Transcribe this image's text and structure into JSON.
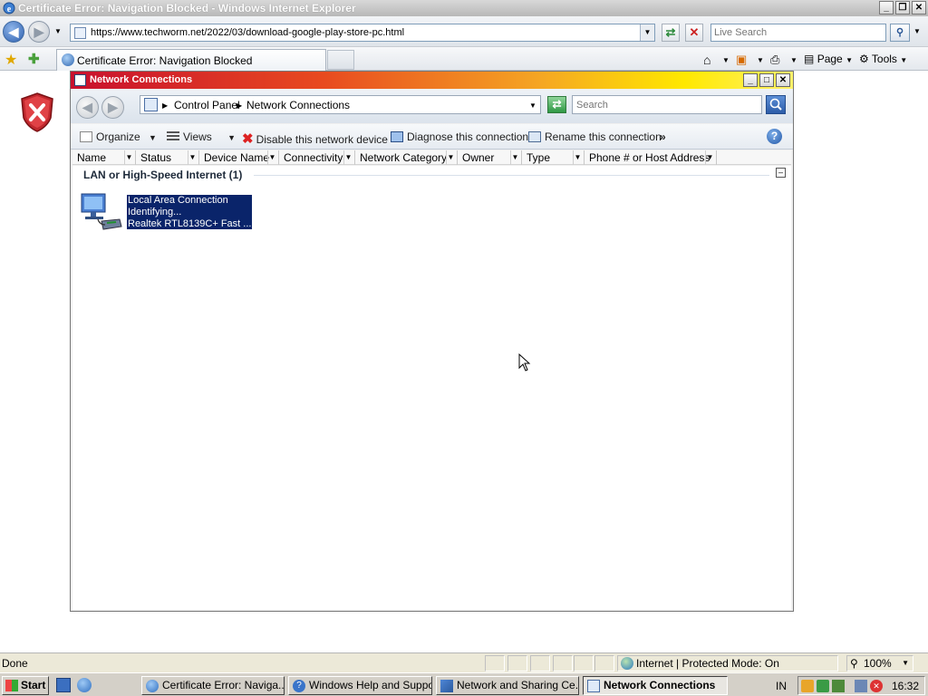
{
  "browser": {
    "title": "Certificate Error: Navigation Blocked - Windows Internet Explorer",
    "url": "https://www.techworm.net/2022/03/download-google-play-store-pc.html",
    "search_placeholder": "Live Search",
    "tab_label": "Certificate Error: Navigation Blocked",
    "page_menu": "Page",
    "tools_menu": "Tools",
    "status_text": "Done",
    "zone_text": "Internet | Protected Mode: On",
    "zoom_text": "100%"
  },
  "window": {
    "title": "Network Connections",
    "breadcrumb": [
      "Control Panel",
      "Network Connections"
    ],
    "search_placeholder": "Search",
    "commands": {
      "organize": "Organize",
      "views": "Views",
      "disable": "Disable this network device",
      "diagnose": "Diagnose this connection",
      "rename": "Rename this connection",
      "more": "»"
    },
    "columns": [
      "Name",
      "Status",
      "Device Name",
      "Connectivity",
      "Network Category",
      "Owner",
      "Type",
      "Phone # or Host Address"
    ],
    "group_header": "LAN or High-Speed Internet (1)",
    "connection": {
      "name": "Local Area Connection",
      "status": "Identifying...",
      "device": "Realtek RTL8139C+ Fast ..."
    }
  },
  "taskbar": {
    "start": "Start",
    "tasks": [
      "Certificate Error: Naviga...",
      "Windows Help and Support",
      "Network and Sharing Ce...",
      "Network Connections"
    ],
    "language": "IN",
    "clock": "16:32"
  },
  "colors": {
    "window_title_gradient": [
      "#c8102e",
      "#f5a623",
      "#ffe800"
    ],
    "selection": "#0a246a",
    "error_shield": "#c0282d"
  },
  "icons": [
    "back-icon",
    "forward-icon",
    "refresh-icon",
    "stop-icon",
    "search-icon",
    "favorites-star-icon",
    "add-favorites-icon",
    "home-icon",
    "rss-icon",
    "print-icon",
    "page-icon",
    "tools-gear-icon",
    "error-shield-icon",
    "network-computer-icon",
    "help-icon",
    "cursor-icon"
  ]
}
